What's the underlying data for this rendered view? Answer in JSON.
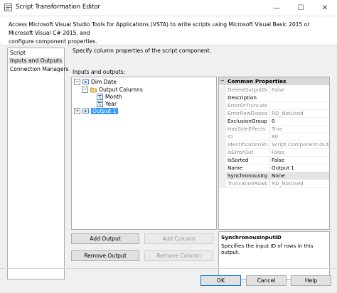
{
  "window": {
    "title": "Script Transformation Editor",
    "minimize": "—",
    "maximize": "☐",
    "close": "✕"
  },
  "banner": {
    "line1": "Access Microsoft Visual Studio Tools for Applications (VSTA) to write scripts using Microsoft Visual Basic 2015 or Microsoft Visual C# 2015, and",
    "line2": "configure component properties."
  },
  "nav": {
    "items": [
      {
        "label": "Script"
      },
      {
        "label": "Inputs and Outputs"
      },
      {
        "label": "Connection Managers"
      }
    ]
  },
  "main": {
    "description": "Specify column properties of the script component.",
    "inputs_outputs_label": "Inputs and outputs:",
    "tree": {
      "dim_date": {
        "label": "Dim Date",
        "expander": "−"
      },
      "output_columns": {
        "label": "Output Columns",
        "expander": "−"
      },
      "month": {
        "label": "Month"
      },
      "year": {
        "label": "Year"
      },
      "output1": {
        "label": "Output 1",
        "expander": "+"
      }
    }
  },
  "properties": {
    "section_title": "Common Properties",
    "collapse_glyph": "−",
    "rows": [
      {
        "name": "DeleteOutputOnPa",
        "value": "False",
        "readonly": true
      },
      {
        "name": "Description",
        "value": "",
        "readonly": false
      },
      {
        "name": "ErrorOrTruncation",
        "value": "",
        "readonly": true
      },
      {
        "name": "ErrorRowDispositio",
        "value": "RD_NotUsed",
        "readonly": true
      },
      {
        "name": "ExclusionGroup",
        "value": "0",
        "readonly": false
      },
      {
        "name": "HasSideEffects",
        "value": "True",
        "readonly": true
      },
      {
        "name": "ID",
        "value": "80",
        "readonly": true
      },
      {
        "name": "IdentificationStrin",
        "value": "Script Component.Outputs",
        "readonly": true
      },
      {
        "name": "IsErrorOut",
        "value": "False",
        "readonly": true
      },
      {
        "name": "IsSorted",
        "value": "False",
        "readonly": false
      },
      {
        "name": "Name",
        "value": "Output 1",
        "readonly": false
      },
      {
        "name": "SynchronousInput",
        "value": "None",
        "readonly": false
      },
      {
        "name": "TruncationRowDis",
        "value": "RD_NotUsed",
        "readonly": true
      }
    ],
    "help_title": "SynchronousInputID",
    "help_text": "Specifies the input ID of rows in this output."
  },
  "buttons": {
    "add_output": "Add Output",
    "add_column": "Add Column",
    "remove_output": "Remove Output",
    "remove_column": "Remove Column",
    "ok": "OK",
    "cancel": "Cancel",
    "help": "Help"
  }
}
